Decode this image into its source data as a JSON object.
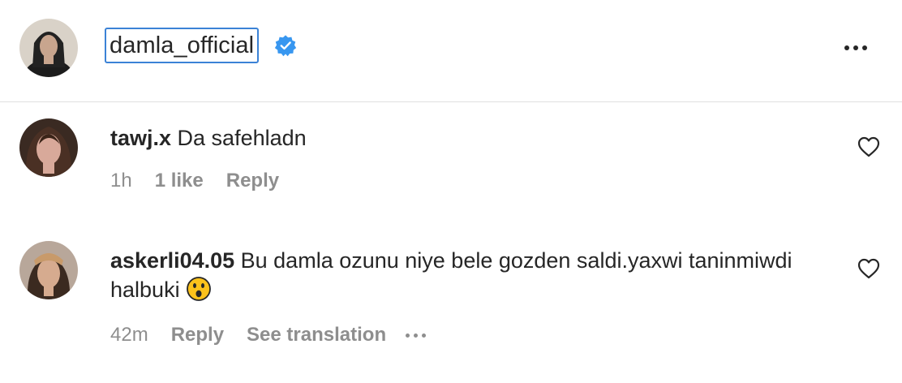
{
  "post": {
    "author": {
      "username": "damla_official",
      "verified": true,
      "avatar": "avatar-icon"
    },
    "more_icon": "more-options-icon"
  },
  "comments": [
    {
      "username": "tawj.x",
      "text": " Da safehladn",
      "time": "1h",
      "likes": "1 like",
      "reply_label": "Reply",
      "avatar": "avatar-icon"
    },
    {
      "username": "askerli04.05",
      "text": " Bu damla ozunu niye bele gozden saldi.yaxwi taninmiwdi halbuki",
      "emoji": "astonished-face-emoji",
      "time": "42m",
      "reply_label": "Reply",
      "translation_label": "See translation",
      "avatar": "avatar-icon"
    }
  ],
  "colors": {
    "verified_blue": "#3897f0",
    "focus_outline": "#3b82d6",
    "meta_gray": "#8e8e8e",
    "text": "#262626"
  }
}
